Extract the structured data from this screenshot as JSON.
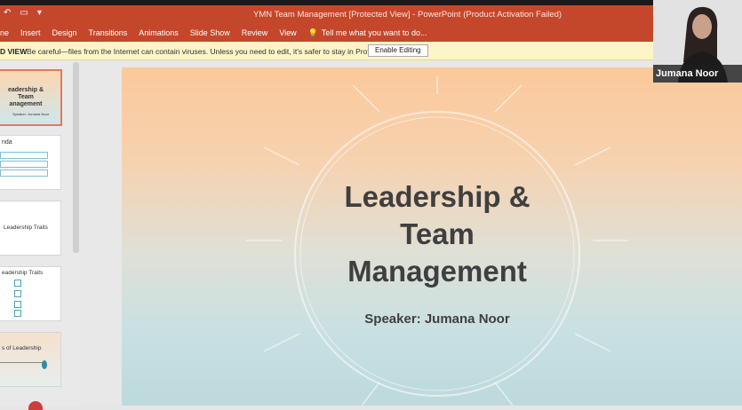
{
  "window": {
    "title": "YMN Team Management [Protected View] - PowerPoint (Product Activation Failed)"
  },
  "ribbon": {
    "tabs": [
      "ne",
      "Insert",
      "Design",
      "Transitions",
      "Animations",
      "Slide Show",
      "Review",
      "View"
    ],
    "tell_me": "Tell me what you want to do..."
  },
  "protected_view": {
    "label": "D VIEW",
    "message": "Be careful—files from the Internet can contain viruses. Unless you need to edit, it's safer to stay in Protected View.",
    "button": "Enable Editing"
  },
  "thumbnails": [
    {
      "title": "eadership & Team anagement",
      "sub": "Speaker: Jumana Noor"
    },
    {
      "title": "nda",
      "sub": ""
    },
    {
      "title": "Leadership Traits",
      "sub": ""
    },
    {
      "title": "eadership Traits",
      "sub": ""
    },
    {
      "title": "s of Leadership",
      "sub": ""
    }
  ],
  "slide": {
    "title_lines": [
      "Leadership &",
      "Team",
      "Management"
    ],
    "speaker": "Speaker: Jumana Noor"
  },
  "webcam": {
    "name": "Jumana Noor"
  },
  "colors": {
    "ribbon": "#c4472b",
    "pv_bar": "#fcf5c7",
    "slide_text": "#3f3f3f"
  }
}
